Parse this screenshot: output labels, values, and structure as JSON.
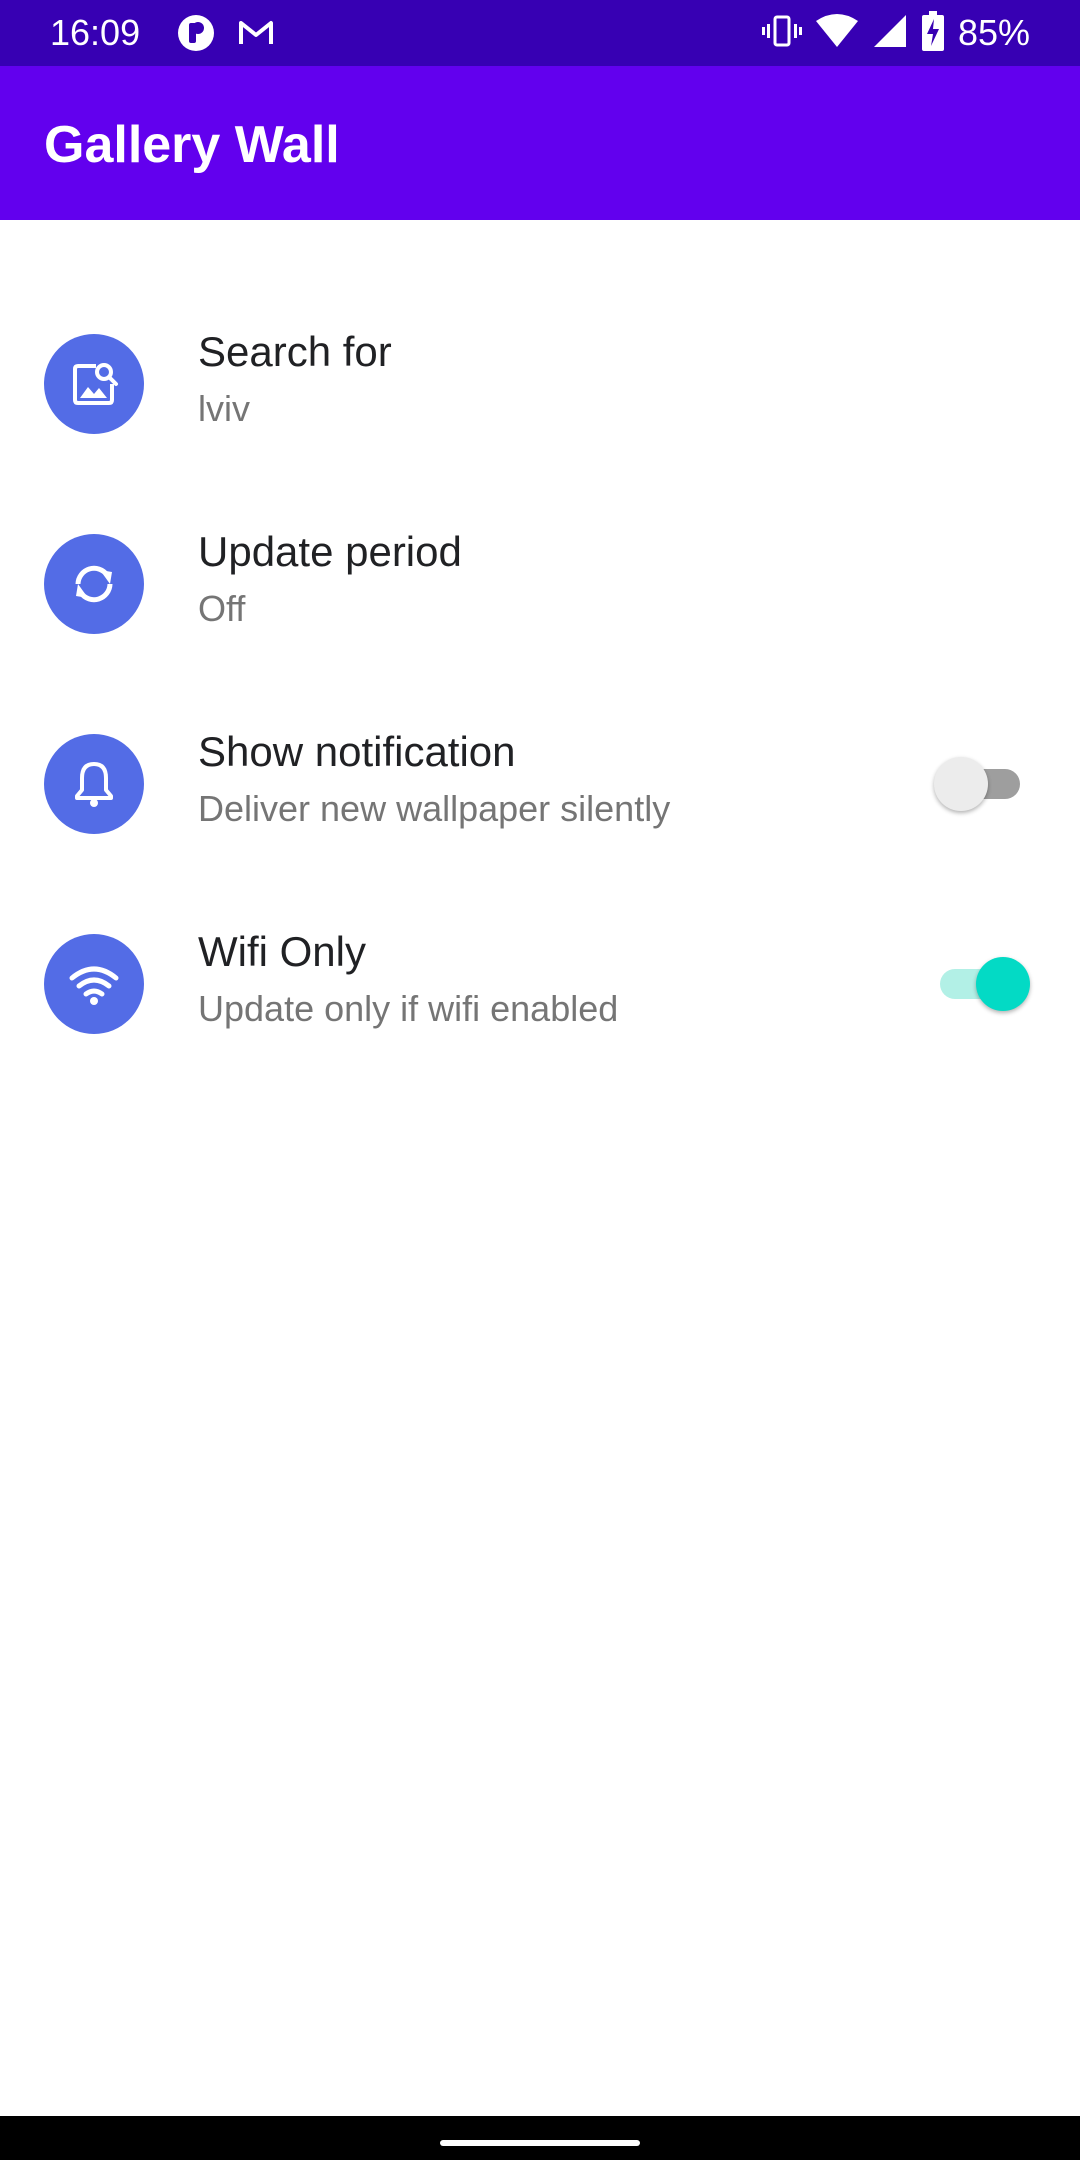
{
  "status_bar": {
    "time": "16:09",
    "battery": "85%",
    "left_icons": [
      "app-notification-icon",
      "gmail-icon"
    ],
    "right_icons": [
      "vibrate-icon",
      "wifi-signal-icon",
      "cell-signal-icon",
      "battery-charging-icon"
    ]
  },
  "app_bar": {
    "title": "Gallery Wall",
    "color": "#6200ee"
  },
  "settings": [
    {
      "title": "Search for",
      "summary": "lviv",
      "icon": "image-search-icon"
    },
    {
      "title": "Update period",
      "summary": "Off",
      "icon": "sync-icon"
    },
    {
      "title": "Show notification",
      "summary": "Deliver new wallpaper silently",
      "icon": "bell-icon",
      "switch": false
    },
    {
      "title": "Wifi Only",
      "summary": "Update only if wifi enabled",
      "icon": "wifi-icon",
      "switch": true
    }
  ],
  "colors": {
    "status_bar": "#3700b3",
    "icon_circle": "#536ce6",
    "switch_on": "#03dac5"
  }
}
